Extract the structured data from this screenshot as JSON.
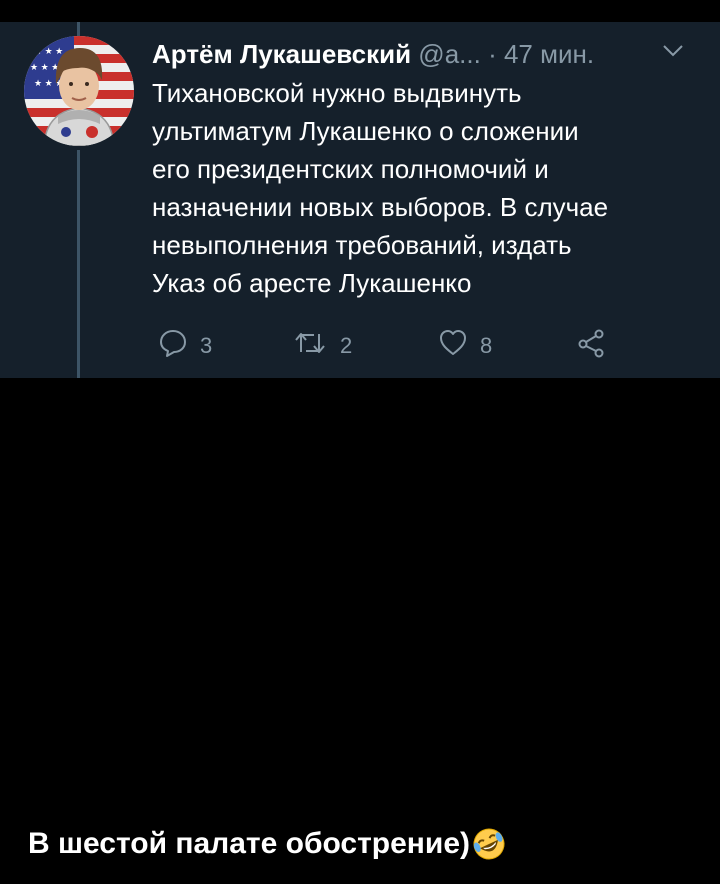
{
  "tweet": {
    "author_name": "Артём Лукашевский",
    "author_handle": "@a...",
    "separator": "·",
    "time_ago": "47 мин.",
    "text_lines": [
      "Тихановской нужно выдвинуть",
      "ультиматум Лукашенко о сложении",
      "его президентских полномочий и",
      "назначении новых выборов. В случае",
      "невыполнения требований, издать",
      "Указ об аресте Лукашенко"
    ],
    "actions": {
      "reply_count": "3",
      "retweet_count": "2",
      "like_count": "8"
    },
    "icons": {
      "reply": "reply-icon",
      "retweet": "retweet-icon",
      "like": "heart-icon",
      "share": "share-icon",
      "menu": "chevron-down-icon"
    }
  },
  "caption": {
    "text": "В шестой палате обострение)",
    "emoji": "rolling-on-the-floor-laughing-emoji"
  },
  "colors": {
    "card_background": "#15202b",
    "page_background": "#000000",
    "primary_text": "#ffffff",
    "secondary_text": "#8899a6",
    "thread_line": "#3d5466"
  }
}
